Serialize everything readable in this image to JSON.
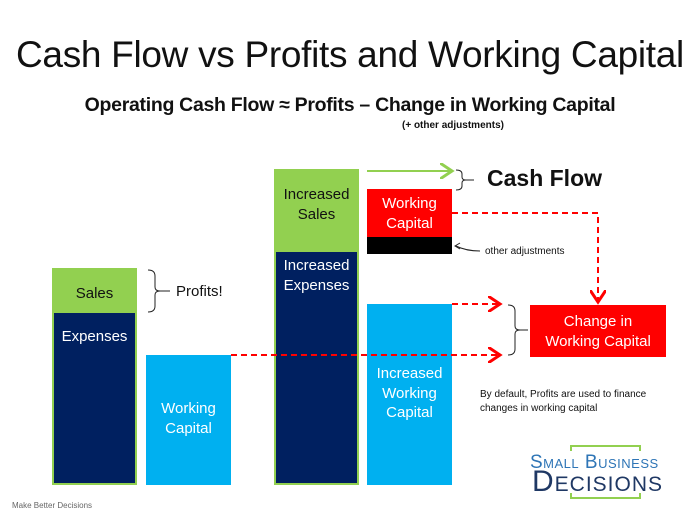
{
  "title": "Cash Flow vs Profits and Working Capital",
  "subtitle": "Operating Cash Flow ≈ Profits – Change in Working Capital",
  "subtitle_note": "(+ other adjustments)",
  "blocks": {
    "sales": "Sales",
    "expenses": "Expenses",
    "working_capital": "Working Capital",
    "increased_sales": "Increased Sales",
    "increased_expenses": "Increased Expenses",
    "increased_working_capital": "Increased Working Capital",
    "wc_outflow": "Working Capital",
    "change_in_wc": "Change in Working Capital"
  },
  "labels": {
    "profits": "Profits!",
    "cash_flow": "Cash Flow",
    "other_adjustments": "other adjustments",
    "note": "By default, Profits are used to finance changes in working capital"
  },
  "colors": {
    "sales_green": "#92d050",
    "expenses_navy": "#002060",
    "wc_cyan": "#00b0f0",
    "alert_red": "#ff0000"
  },
  "logo": {
    "line1": "Small Business",
    "line2": "Decisions"
  },
  "footer": "Make Better Decisions"
}
